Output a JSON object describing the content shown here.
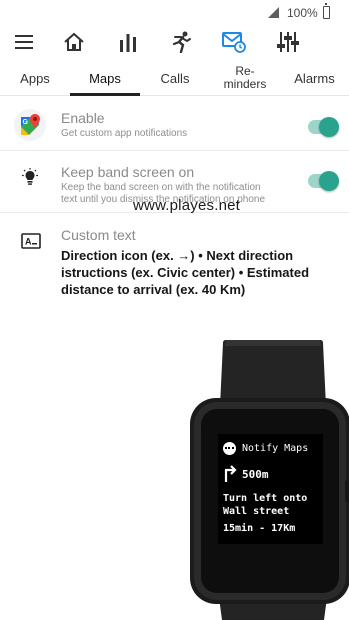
{
  "status_bar": {
    "battery_text": "100%",
    "icons": [
      "signal-icon",
      "battery-icon"
    ]
  },
  "toolbar": {
    "icons": [
      "menu-icon",
      "home-icon",
      "stats-icon",
      "workout-icon",
      "notifications-icon",
      "equalizer-icon"
    ],
    "active_icon": "notifications-icon",
    "accent_color": "#1e88e5"
  },
  "tabs": [
    {
      "label": "Apps"
    },
    {
      "label": "Maps"
    },
    {
      "label": "Calls"
    },
    {
      "label": "Re-\nminders"
    },
    {
      "label": "Alarms"
    }
  ],
  "active_tab": "Maps",
  "settings": {
    "enable": {
      "title": "Enable",
      "subtitle": "Get custom app notifications",
      "toggle_on": true
    },
    "keep_screen": {
      "title": "Keep band screen on",
      "subtitle_line1": "Keep the band screen on with the notification",
      "subtitle_line2": "text until you dismiss the notification on phone",
      "toggle_on": true
    },
    "custom_text": {
      "title": "Custom text",
      "body": "Direction icon (ex. →) • Next direction istructions (ex. Civic center) • Estimated distance to arrival (ex. 40 Km)"
    }
  },
  "watermark": "www.playes.net",
  "watch_screen": {
    "app_name": "Notify Maps",
    "distance": "500m",
    "instruction_line1": "Turn left onto",
    "instruction_line2": "Wall street",
    "eta": "15min - 17Km"
  },
  "colors": {
    "toggle_track": "#9ed5cb",
    "toggle_knob": "#2aa38e",
    "accent": "#1e88e5"
  }
}
